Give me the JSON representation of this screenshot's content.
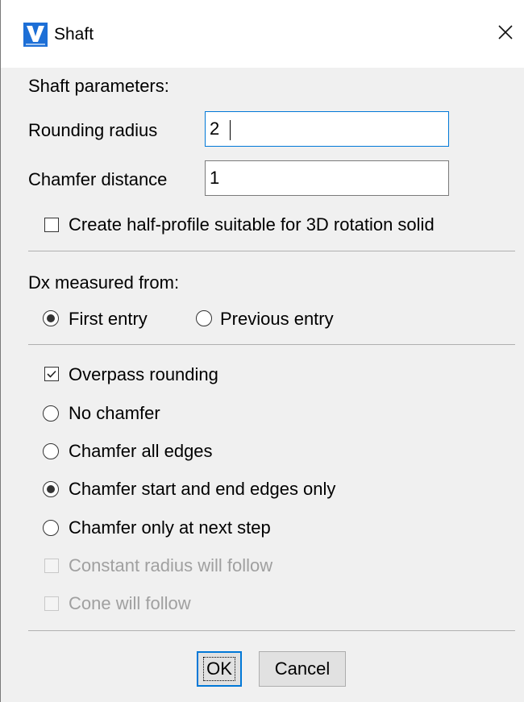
{
  "window": {
    "title": "Shaft",
    "icon": "vericad-logo-icon",
    "close_icon": "close-icon"
  },
  "shaft_parameters": {
    "heading": "Shaft parameters:",
    "rounding_radius_label": "Rounding radius",
    "rounding_radius_value": "2",
    "chamfer_distance_label": "Chamfer distance",
    "chamfer_distance_value": "1",
    "half_profile_label": "Create half-profile suitable for 3D rotation solid",
    "half_profile_checked": false
  },
  "dx_measured": {
    "heading": "Dx measured from:",
    "options": [
      {
        "label": "First entry",
        "selected": true
      },
      {
        "label": "Previous entry",
        "selected": false
      }
    ]
  },
  "options": {
    "overpass_rounding_label": "Overpass rounding",
    "overpass_rounding_checked": true,
    "chamfer_modes": [
      {
        "label": "No chamfer",
        "selected": false
      },
      {
        "label": "Chamfer all edges",
        "selected": false
      },
      {
        "label": "Chamfer start and end edges only",
        "selected": true
      },
      {
        "label": "Chamfer only at next step",
        "selected": false
      }
    ],
    "constant_radius_label": "Constant radius will follow",
    "constant_radius_enabled": false,
    "cone_label": "Cone will follow",
    "cone_enabled": false
  },
  "buttons": {
    "ok_label": "OK",
    "cancel_label": "Cancel"
  },
  "colors": {
    "dialog_bg": "#f0f0f0",
    "focus_blue": "#0078d7",
    "logo_blue": "#1d6fd6",
    "disabled_text": "#a0a0a0"
  }
}
